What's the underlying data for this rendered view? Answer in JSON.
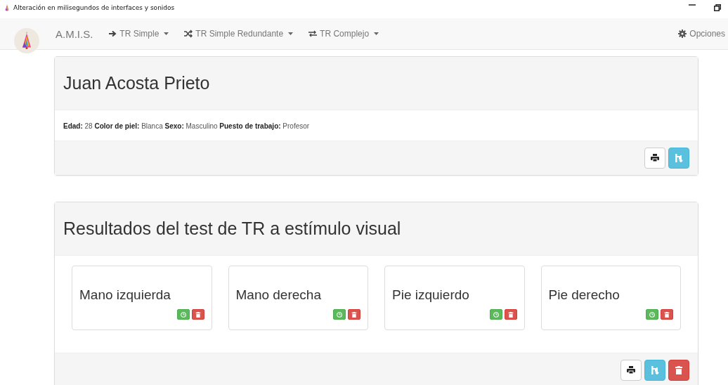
{
  "window": {
    "title": "Alteración en milisegundos de interfaces y sonidos"
  },
  "navbar": {
    "brand": "A.M.I.S.",
    "menus": [
      {
        "label": "TR Simple",
        "kind": "arrow"
      },
      {
        "label": "TR Simple Redundante",
        "kind": "shuffle"
      },
      {
        "label": "TR Complejo",
        "kind": "swap"
      }
    ],
    "options": "Opciones"
  },
  "person_panel": {
    "name": "Juan Acosta Prieto",
    "details": "**Edad:** 28 **Color de piel:** Blanca **Sexo:** Masculino **Puesto de trabajo:** Profesor",
    "buttons": [
      {
        "kind": "print"
      },
      {
        "kind": "export"
      }
    ]
  },
  "results_panel": {
    "title": "Resultados del test de TR a estímulo visual",
    "cards": [
      {
        "label": "Mano izquierda",
        "buttons": [
          {
            "kind": "time"
          },
          {
            "kind": "delete"
          }
        ]
      },
      {
        "label": "Mano derecha",
        "buttons": [
          {
            "kind": "time"
          },
          {
            "kind": "delete"
          }
        ]
      },
      {
        "label": "Pie izquierdo",
        "buttons": [
          {
            "kind": "time"
          },
          {
            "kind": "delete"
          }
        ]
      },
      {
        "label": "Pie derecho",
        "buttons": [
          {
            "kind": "time"
          },
          {
            "kind": "delete"
          }
        ]
      }
    ],
    "buttons": [
      {
        "kind": "print"
      },
      {
        "kind": "export"
      },
      {
        "kind": "delete"
      }
    ]
  }
}
